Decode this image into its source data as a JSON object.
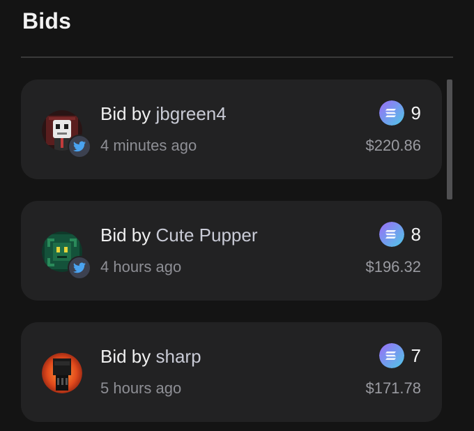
{
  "panel": {
    "title": "Bids"
  },
  "bids": [
    {
      "prefix": "Bid by",
      "user": "jbgreen4",
      "time": "4 minutes ago",
      "amount": "9",
      "usd": "$220.86",
      "avatar": "skull-avatar",
      "has_twitter": true
    },
    {
      "prefix": "Bid by",
      "user": "Cute Pupper",
      "time": "4 hours ago",
      "amount": "8",
      "usd": "$196.32",
      "avatar": "green-robot-avatar",
      "has_twitter": true
    },
    {
      "prefix": "Bid by",
      "user": "sharp",
      "time": "5 hours ago",
      "amount": "7",
      "usd": "$171.78",
      "avatar": "dark-figure-avatar",
      "has_twitter": false
    }
  ],
  "icons": {
    "currency": "solana-icon",
    "social": "twitter-icon"
  },
  "colors": {
    "background": "#141414",
    "card": "#222223",
    "twitter": "#4aa3f0",
    "sol_gradient_start": "#9b6cf7",
    "sol_gradient_end": "#4ec8e6"
  }
}
